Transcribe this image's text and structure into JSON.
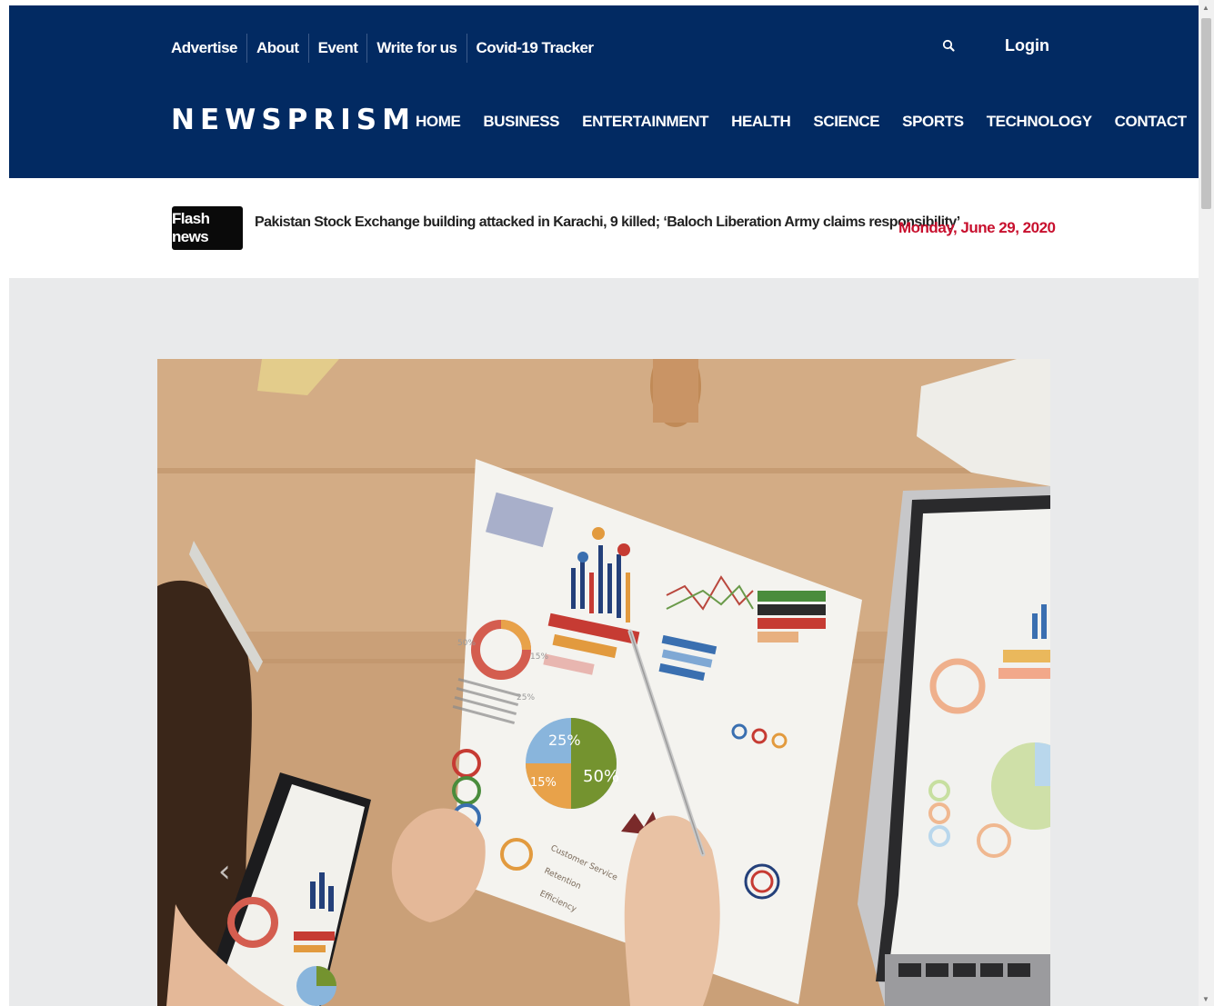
{
  "topbar": {
    "links": [
      "Advertise",
      "About",
      "Event",
      "Write for us",
      "Covid-19 Tracker"
    ],
    "login_label": "Login"
  },
  "brand": {
    "name": "NEWSPRISM"
  },
  "nav": {
    "items": [
      "HOME",
      "BUSINESS",
      "ENTERTAINMENT",
      "HEALTH",
      "SCIENCE",
      "SPORTS",
      "TECHNOLOGY",
      "CONTACT"
    ]
  },
  "ticker": {
    "badge": "Flash news",
    "headline": "Pakistan Stock Exchange building attacked in Karachi, 9 killed; ‘Baloch Liberation Army claims responsibility’",
    "date": "Monday, June 29, 2020"
  },
  "hero": {
    "pie_labels": [
      "25%",
      "15%",
      "50%"
    ],
    "donut_labels": [
      "50%",
      "15%",
      "25%"
    ],
    "legend": [
      "Customer Service",
      "Retention",
      "Efficiency"
    ]
  },
  "colors": {
    "header_bg": "#022a62",
    "date_red": "#c8102e",
    "badge_bg": "#0a0a0a",
    "content_bg": "#e9eaeb"
  },
  "icons": {
    "search": "search-icon",
    "carousel_prev": "chevron-left-icon"
  }
}
